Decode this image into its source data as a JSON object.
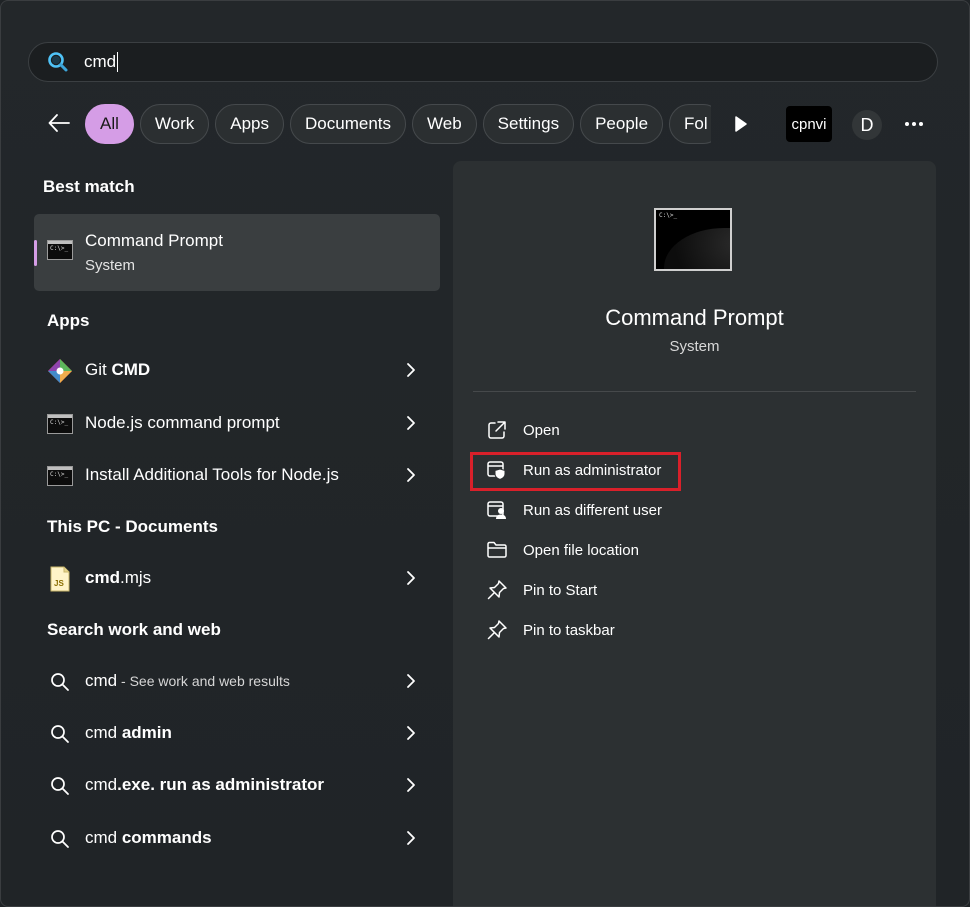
{
  "search": {
    "query": "cmd",
    "icon": "search-icon"
  },
  "filters": {
    "back_icon": "arrow-left-icon",
    "chips": [
      "All",
      "Work",
      "Apps",
      "Documents",
      "Web",
      "Settings",
      "People",
      "Fol"
    ],
    "active": "All",
    "org_label": "cpnvi",
    "avatar_letter": "D",
    "more_icon": "more-horizontal-icon"
  },
  "best_match": {
    "title": "Best match",
    "name": "Command Prompt",
    "type": "System"
  },
  "apps": {
    "title": "Apps",
    "items": [
      {
        "prefix": "Git ",
        "bold": "CMD",
        "icon": "git-icon"
      },
      {
        "prefix": "Node.js command prompt",
        "bold": "",
        "icon": "terminal-icon"
      },
      {
        "prefix": "Install Additional Tools for Node.js",
        "bold": "",
        "icon": "terminal-icon"
      }
    ]
  },
  "documents": {
    "title": "This PC - Documents",
    "items": [
      {
        "bold": "cmd",
        "suffix": ".mjs",
        "icon": "js-file-icon"
      }
    ]
  },
  "web": {
    "title": "Search work and web",
    "items": [
      {
        "main": "cmd",
        "bold": "",
        "muted": " - See work and web results"
      },
      {
        "main": "cmd ",
        "bold": "admin",
        "muted": ""
      },
      {
        "main": "cmd",
        "bold": ".exe. run as administrator",
        "muted": ""
      },
      {
        "main": "cmd ",
        "bold": "commands",
        "muted": ""
      }
    ]
  },
  "detail": {
    "title": "Command Prompt",
    "subtitle": "System",
    "actions": [
      {
        "label": "Open",
        "icon": "open-external-icon"
      },
      {
        "label": "Run as administrator",
        "icon": "shield-admin-icon"
      },
      {
        "label": "Run as different user",
        "icon": "user-switch-icon"
      },
      {
        "label": "Open file location",
        "icon": "folder-icon"
      },
      {
        "label": "Pin to Start",
        "icon": "pin-icon"
      },
      {
        "label": "Pin to taskbar",
        "icon": "pin-icon"
      }
    ],
    "highlighted_action": "Run as administrator"
  },
  "colors": {
    "accent": "#d59de6",
    "highlight_box": "#d9202a",
    "background": "#202427",
    "panel": "#2c3032"
  }
}
